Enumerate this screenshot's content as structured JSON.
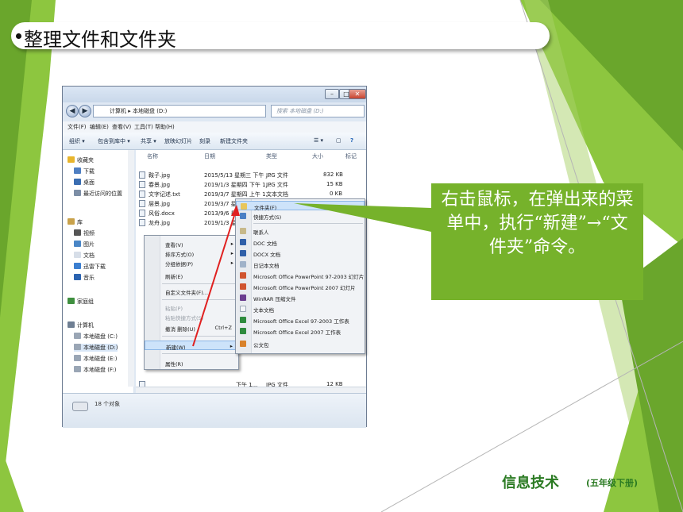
{
  "slide_title": "整理文件和文件夹",
  "callout_text": "右击鼠标，在弹出来的菜单中，执行“新建”→“文件夹”命令。",
  "logo": {
    "main": "信息技术",
    "sub": "(五年级下册)"
  },
  "explorer": {
    "address": "计算机 ▸ 本地磁盘 (D:)",
    "search_placeholder": "搜索 本地磁盘 (D:)",
    "menu": [
      "文件(F)",
      "编辑(E)",
      "查看(V)",
      "工具(T)",
      "帮助(H)"
    ],
    "toolbar": [
      "组织 ▾",
      "包含到库中 ▾",
      "共享 ▾",
      "放映幻灯片",
      "刻录",
      "新建文件夹"
    ],
    "nav": {
      "favorites": "收藏夹",
      "fav_items": [
        "下载",
        "桌面",
        "最近访问的位置"
      ],
      "library": "库",
      "lib_items": [
        "视频",
        "图片",
        "文档",
        "迅雷下载",
        "音乐"
      ],
      "homegroup": "家庭组",
      "computer": "计算机",
      "drives": [
        "本地磁盘 (C:)",
        "本地磁盘 (D:)",
        "本地磁盘 (E:)",
        "本地磁盘 (F:)"
      ]
    },
    "columns": [
      "名称",
      "日期",
      "类型",
      "大小",
      "标记"
    ],
    "files": [
      {
        "name": "鞍子.jpg",
        "date": "2015/5/13 星期三 下午 ...",
        "type": "JPG 文件",
        "size": "832 KB"
      },
      {
        "name": "春景.jpg",
        "date": "2019/1/3 星期四 下午 1...",
        "type": "JPG 文件",
        "size": "15 KB"
      },
      {
        "name": "文字记述.txt",
        "date": "2019/3/7 星期四 上午 1...",
        "type": "文本文档",
        "size": "0 KB"
      },
      {
        "name": "层景.jpg",
        "date": "2019/3/7 星期四",
        "type": "",
        "size": ""
      },
      {
        "name": "风俗.docx",
        "date": "2013/9/6 星期五",
        "type": "",
        "size": ""
      },
      {
        "name": "龙舟.jpg",
        "date": "2019/1/3 星期四",
        "type": "",
        "size": ""
      }
    ],
    "last_row": {
      "date": "下午 1...",
      "type": "JPG 文件",
      "size": "12 KB"
    },
    "status": "18 个对象"
  },
  "context_menu": [
    {
      "label": "查看(V)",
      "arrow": "▸"
    },
    {
      "label": "排序方式(O)",
      "arrow": "▸"
    },
    {
      "label": "分组依据(P)",
      "arrow": "▸"
    },
    {
      "label": "刷新(E)"
    },
    {
      "label": "自定义文件夹(F)..."
    },
    {
      "label": "粘贴(P)"
    },
    {
      "label": "粘贴快捷方式(S)"
    },
    {
      "label": "撤消 删除(U)",
      "shortcut": "Ctrl+Z"
    },
    {
      "label": "新建(W)",
      "arrow": "▸"
    },
    {
      "label": "属性(R)"
    }
  ],
  "submenu": [
    "文件夹(F)",
    "快捷方式(S)",
    "联系人",
    "DOC 文档",
    "DOCX 文档",
    "日记本文档",
    "Microsoft Office PowerPoint 97-2003 幻灯片",
    "Microsoft Office PowerPoint 2007 幻灯片",
    "WinRAR 压缩文件",
    "文本文档",
    "Microsoft Office Excel 97-2003 工作表",
    "Microsoft Office Excel 2007 工作表",
    "公文包"
  ]
}
